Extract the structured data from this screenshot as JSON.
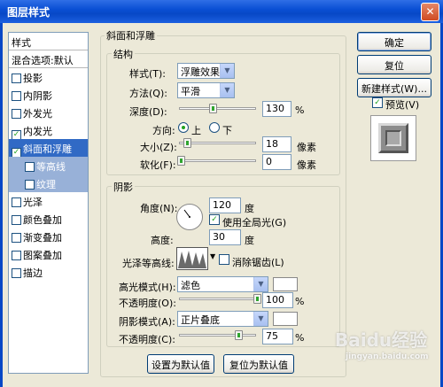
{
  "window": {
    "title": "图层样式",
    "close_symbol": "✕"
  },
  "sidebar": {
    "header": "样式",
    "blending": "混合选项:默认",
    "items": [
      {
        "label": "投影",
        "checked": false
      },
      {
        "label": "内阴影",
        "checked": false
      },
      {
        "label": "外发光",
        "checked": false
      },
      {
        "label": "内发光",
        "checked": true
      },
      {
        "label": "斜面和浮雕",
        "checked": true,
        "selected": true
      },
      {
        "label": "等高线",
        "checked": false,
        "sub": true
      },
      {
        "label": "纹理",
        "checked": false,
        "sub": true
      },
      {
        "label": "光泽",
        "checked": false
      },
      {
        "label": "颜色叠加",
        "checked": false
      },
      {
        "label": "渐变叠加",
        "checked": false
      },
      {
        "label": "图案叠加",
        "checked": false
      },
      {
        "label": "描边",
        "checked": false
      }
    ],
    "check_mark": "✓"
  },
  "bevel": {
    "title": "斜面和浮雕",
    "structure": {
      "title": "结构",
      "style_label": "样式(T):",
      "style_value": "浮雕效果",
      "technique_label": "方法(Q):",
      "technique_value": "平滑",
      "depth_label": "深度(D):",
      "depth_value": "130",
      "depth_unit": "%",
      "direction_label": "方向:",
      "direction_up": "上",
      "direction_down": "下",
      "size_label": "大小(Z):",
      "size_value": "18",
      "size_unit": "像素",
      "soften_label": "软化(F):",
      "soften_value": "0",
      "soften_unit": "像素"
    },
    "shading": {
      "title": "阴影",
      "angle_label": "角度(N):",
      "angle_value": "120",
      "angle_unit": "度",
      "global_light": "使用全局光(G)",
      "altitude_label": "高度:",
      "altitude_value": "30",
      "altitude_unit": "度",
      "gloss_label": "光泽等高线:",
      "antialiased": "消除锯齿(L)",
      "highlight_label": "高光模式(H):",
      "highlight_value": "滤色",
      "highlight_opacity_label": "不透明度(O):",
      "highlight_opacity_value": "100",
      "shadow_label": "阴影模式(A):",
      "shadow_value": "正片叠底",
      "shadow_opacity_label": "不透明度(C):",
      "shadow_opacity_value": "75",
      "opacity_unit": "%"
    },
    "make_default": "设置为默认值",
    "reset_default": "复位为默认值"
  },
  "buttons": {
    "ok": "确定",
    "reset": "复位",
    "new_style": "新建样式(W)...",
    "preview": "预览(V)"
  },
  "watermark": {
    "brand": "Baidu经验",
    "url": "jingyan.baidu.com"
  },
  "colors": {
    "titlebar": "#0748c6",
    "selection": "#316ac5",
    "checkmark": "#21a121"
  }
}
